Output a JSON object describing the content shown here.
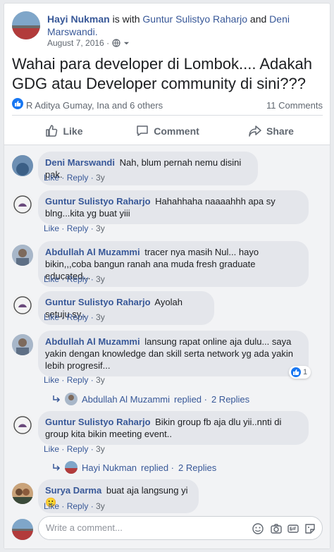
{
  "post": {
    "author": "Hayi Nukman",
    "with_text": "is with",
    "tagged1": "Guntur Sulistyo Raharjo",
    "and_text": "and",
    "tagged2": "Deni Marswandi.",
    "date": "August 7, 2016 ·",
    "text": "Wahai para developer di Lombok.... Adakah GDG atau Developer community di sini???",
    "reactors": "R Aditya Gumay, Ina and 6 others",
    "comments_count": "11 Comments"
  },
  "actions": {
    "like": "Like",
    "comment": "Comment",
    "share": "Share"
  },
  "comment_action_labels": {
    "like": "Like",
    "sep": " · ",
    "reply": "Reply"
  },
  "comments": [
    {
      "name": "Deni Marswandi",
      "text": "Nah, blum pernah nemu disini pak.",
      "time": "3y"
    },
    {
      "name": "Guntur Sulistyo Raharjo",
      "text": "Hahahhaha naaaahhh apa sy blng...kita yg buat yiii",
      "time": "3y"
    },
    {
      "name": "Abdullah Al Muzammi",
      "text": "tracer nya masih Nul... hayo bikin,,,coba bangun ranah ana muda fresh graduate educated...",
      "time": "3y"
    },
    {
      "name": "Guntur Sulistyo Raharjo",
      "text": "Ayolah setuju sy..",
      "time": "3y"
    },
    {
      "name": "Abdullah Al Muzammi",
      "text": "lansung rapat online aja dulu... saya yakin dengan knowledge dan skill serta network yg ada yakin lebih progresif...",
      "time": "3y",
      "reactions": "1"
    },
    {
      "name": "Guntur Sulistyo Raharjo",
      "text": "Bikin group fb aja dlu yii..nnti di group kita bikin meeting event..",
      "time": "3y"
    },
    {
      "name": "Surya Darma",
      "text": "buat aja langsung yi 🙂",
      "time": "3y"
    }
  ],
  "replies": [
    {
      "name": "Abdullah Al Muzammi",
      "replied": "replied ·",
      "count": "2 Replies"
    },
    {
      "name": "Hayi Nukman",
      "replied": "replied ·",
      "count": "2 Replies"
    }
  ],
  "composer": {
    "placeholder": "Write a comment..."
  },
  "colors": {
    "link": "#385898",
    "bubble": "#e4e6eb",
    "like_blue": "#1877f2"
  }
}
